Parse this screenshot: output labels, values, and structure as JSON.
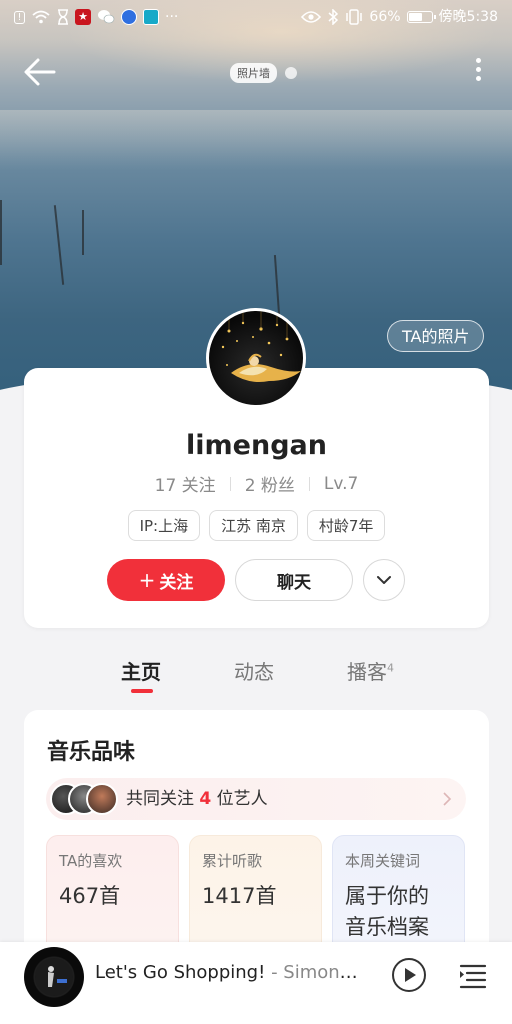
{
  "status_bar": {
    "battery_level": "66%",
    "time": "傍晚5:38",
    "battery_fraction": 0.66,
    "left_icons": [
      "alert-icon",
      "wifi-icon",
      "hourglass-icon",
      "app-red-icon",
      "wechat-icon",
      "browser-icon",
      "app-cyan-icon",
      "ellipsis-icon"
    ],
    "right_icons": [
      "eye-icon",
      "bluetooth-icon",
      "vibrate-icon",
      "battery-icon"
    ],
    "more": "···"
  },
  "header": {
    "photo_wall_label": "照片墙",
    "ta_photos_label": "TA的照片"
  },
  "profile": {
    "username": "limengan",
    "following": "17 关注",
    "followers": "2 粉丝",
    "level": "Lv.7",
    "tags": [
      "IP:上海",
      "江苏 南京",
      "村龄7年"
    ],
    "follow_label": "关注",
    "follow_plus": "+",
    "chat_label": "聊天"
  },
  "tabs": {
    "home": "主页",
    "activity": "动态",
    "podcast": "播客",
    "podcast_count": "4"
  },
  "music_taste": {
    "title": "音乐品味",
    "common_prefix": "共同关注",
    "common_count": "4",
    "common_suffix": "位艺人",
    "cards": [
      {
        "label": "TA的喜欢",
        "value": "467首"
      },
      {
        "label": "累计听歌",
        "value": "1417首"
      },
      {
        "label": "本周关键词",
        "value": "属于你的音乐档案"
      }
    ]
  },
  "player": {
    "song_title": "Let's Go Shopping!",
    "artist": "- Simon V..."
  },
  "colors": {
    "accent_red": "#f1303a"
  }
}
